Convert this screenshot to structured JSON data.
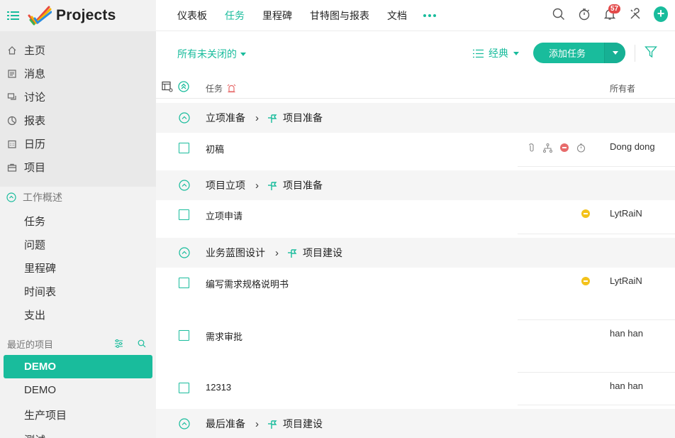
{
  "app": {
    "title": "Projects"
  },
  "sidebar": {
    "main_nav": [
      {
        "label": "主页",
        "icon": "home-icon"
      },
      {
        "label": "消息",
        "icon": "feed-icon"
      },
      {
        "label": "讨论",
        "icon": "discussion-icon"
      },
      {
        "label": "报表",
        "icon": "report-icon"
      },
      {
        "label": "日历",
        "icon": "calendar-icon"
      },
      {
        "label": "项目",
        "icon": "briefcase-icon"
      }
    ],
    "work_overview": {
      "label": "工作概述",
      "items": [
        "任务",
        "问题",
        "里程碑",
        "时间表",
        "支出"
      ]
    },
    "recent": {
      "label": "最近的项目",
      "items": [
        "DEMO",
        "DEMO",
        "生产项目",
        "测试"
      ],
      "active_index": 0
    }
  },
  "topbar": {
    "tabs": [
      "仪表板",
      "任务",
      "里程碑",
      "甘特图与报表",
      "文档"
    ],
    "active_tab": 1,
    "notification_count": "57"
  },
  "toolbar": {
    "filter_label": "所有未关闭的",
    "view_label": "经典",
    "add_task_label": "添加任务"
  },
  "table": {
    "col_task": "任务",
    "col_owner": "所有者",
    "groups": [
      {
        "list": "立项准备",
        "milestone": "项目准备",
        "tasks": [
          {
            "name": "初稿",
            "owner": "Dong dong",
            "status": "red"
          }
        ]
      },
      {
        "list": "项目立项",
        "milestone": "项目准备",
        "tasks": [
          {
            "name": "立项申请",
            "owner": "LytRaiN",
            "status": "yellow"
          }
        ]
      },
      {
        "list": "业务蓝图设计",
        "milestone": "项目建设",
        "tasks": [
          {
            "name": "编写需求规格说明书",
            "owner": "LytRaiN",
            "status": "yellow"
          },
          {
            "name": "需求审批",
            "owner": "han han",
            "status": ""
          },
          {
            "name": "12313",
            "owner": "han han",
            "status": ""
          }
        ]
      },
      {
        "list": "最后准备",
        "milestone": "项目建设",
        "tasks": []
      }
    ]
  },
  "colors": {
    "accent": "#19bc9c",
    "status_red": "#e76b6b",
    "status_yellow": "#f3c21b",
    "badge": "#e34a4a"
  }
}
